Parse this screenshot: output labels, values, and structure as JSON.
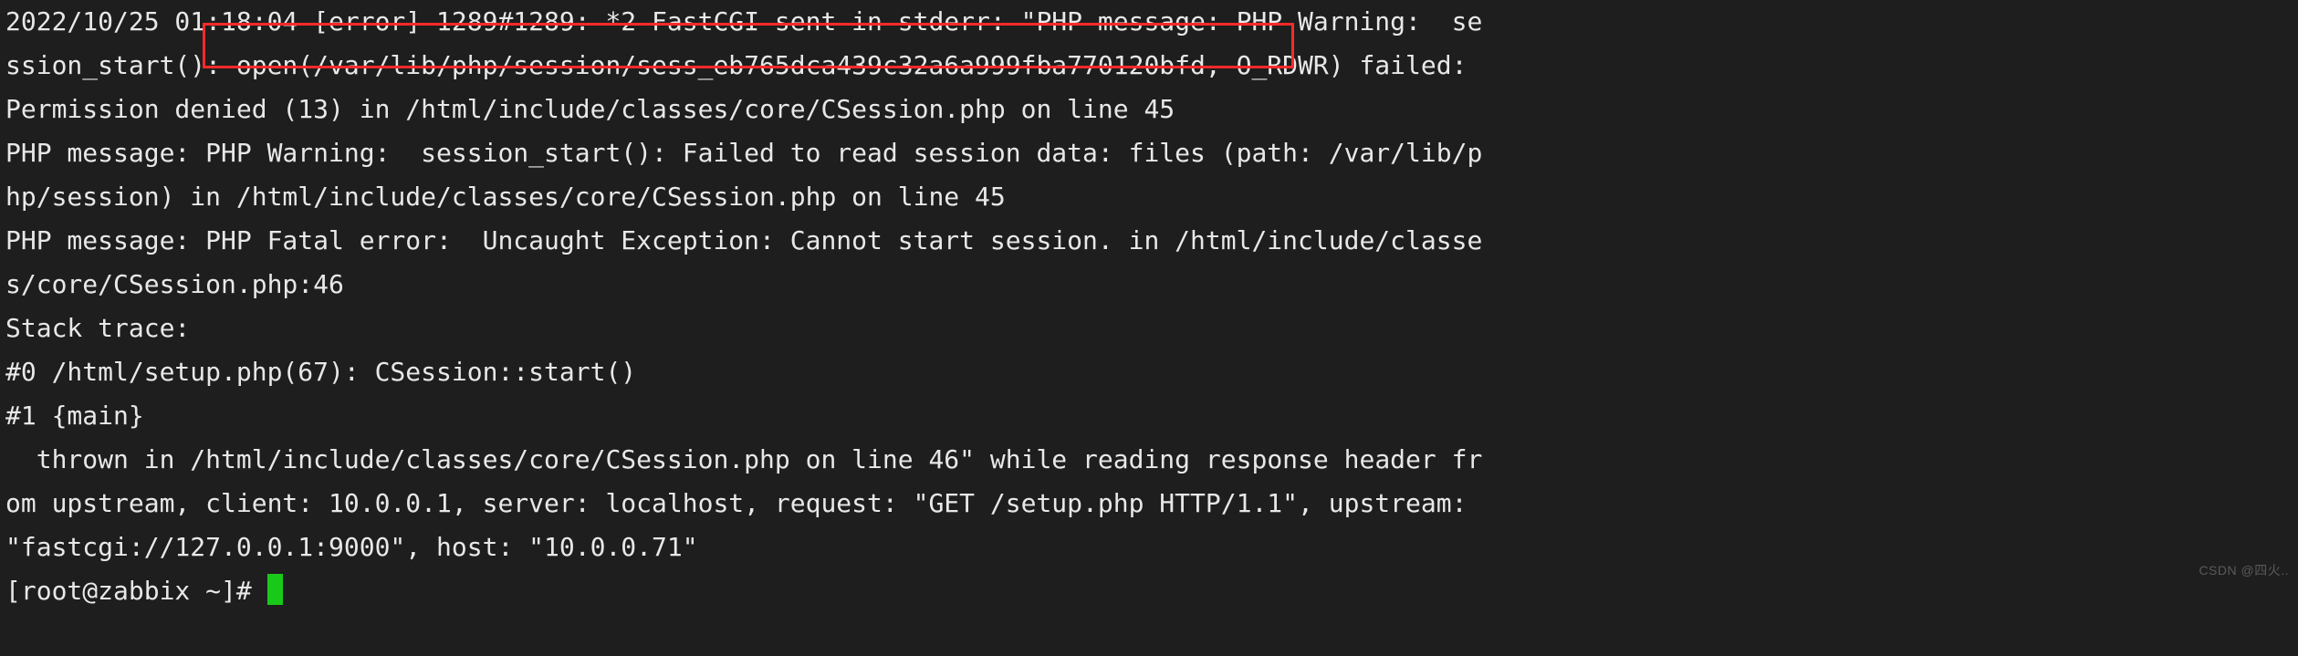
{
  "terminal": {
    "lines": {
      "l1": "2022/10/25 01:18:04 [error] 1289#1289: *2 FastCGI sent in stderr: \"PHP message: PHP Warning:  se",
      "l2": "ssion_start(): open(/var/lib/php/session/sess_eb765dca439c32a6a999fba770120bfd, O_RDWR) failed: ",
      "l3": "Permission denied (13) in /html/include/classes/core/CSession.php on line 45",
      "l4": "PHP message: PHP Warning:  session_start(): Failed to read session data: files (path: /var/lib/p",
      "l5": "hp/session) in /html/include/classes/core/CSession.php on line 45",
      "l6": "PHP message: PHP Fatal error:  Uncaught Exception: Cannot start session. in /html/include/classe",
      "l7": "s/core/CSession.php:46",
      "l8": "Stack trace:",
      "l9": "#0 /html/setup.php(67): CSession::start()",
      "l10": "#1 {main}",
      "l11": "  thrown in /html/include/classes/core/CSession.php on line 46\" while reading response header fr",
      "l12": "om upstream, client: 10.0.0.1, server: localhost, request: \"GET /setup.php HTTP/1.1\", upstream: ",
      "l13": "\"fastcgi://127.0.0.1:9000\", host: \"10.0.0.71\"",
      "prompt_user": "[root@zabbix ",
      "prompt_path": "~",
      "prompt_tail": "]# "
    },
    "highlight_text": "open(/var/lib/php/session/sess_eb765dca439c32a6a999fba770120bfd, O_RDWR)",
    "colors": {
      "bg": "#1e1e1e",
      "fg": "#e8e8e8",
      "cursor": "#19c919",
      "highlight_border": "#ff2a2a"
    }
  },
  "watermark": "CSDN @四火.."
}
